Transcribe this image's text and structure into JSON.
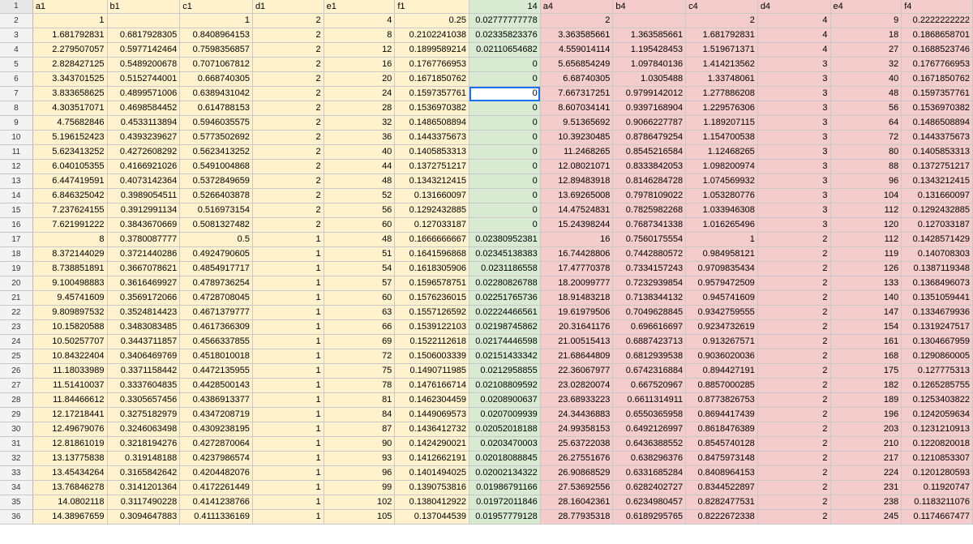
{
  "headers": [
    "a1",
    "b1",
    "c1",
    "d1",
    "e1",
    "f1",
    "14",
    "a4",
    "b4",
    "c4",
    "d4",
    "e4",
    "f4"
  ],
  "colors": {
    "yellow": "#fff2cc",
    "green": "#d9ead3",
    "red": "#f4cccc",
    "selection": "#1a73e8"
  },
  "active_cell": {
    "row": 7,
    "col": "G"
  },
  "rows": [
    [
      "1",
      "",
      "1",
      "2",
      "4",
      "0.25",
      "0.02777777778",
      "2",
      "",
      "2",
      "4",
      "9",
      "0.2222222222"
    ],
    [
      "1.681792831",
      "0.6817928305",
      "0.8408964153",
      "2",
      "8",
      "0.2102241038",
      "0.02335823376",
      "3.363585661",
      "1.363585661",
      "1.681792831",
      "4",
      "18",
      "0.1868658701"
    ],
    [
      "2.279507057",
      "0.5977142464",
      "0.7598356857",
      "2",
      "12",
      "0.1899589214",
      "0.02110654682",
      "4.559014114",
      "1.195428453",
      "1.519671371",
      "4",
      "27",
      "0.1688523746"
    ],
    [
      "2.828427125",
      "0.5489200678",
      "0.7071067812",
      "2",
      "16",
      "0.1767766953",
      "0",
      "5.656854249",
      "1.097840136",
      "1.414213562",
      "3",
      "32",
      "0.1767766953"
    ],
    [
      "3.343701525",
      "0.5152744001",
      "0.668740305",
      "2",
      "20",
      "0.1671850762",
      "0",
      "6.68740305",
      "1.0305488",
      "1.33748061",
      "3",
      "40",
      "0.1671850762"
    ],
    [
      "3.833658625",
      "0.4899571006",
      "0.6389431042",
      "2",
      "24",
      "0.1597357761",
      "0",
      "7.667317251",
      "0.9799142012",
      "1.277886208",
      "3",
      "48",
      "0.1597357761"
    ],
    [
      "4.303517071",
      "0.4698584452",
      "0.614788153",
      "2",
      "28",
      "0.1536970382",
      "0",
      "8.607034141",
      "0.9397168904",
      "1.229576306",
      "3",
      "56",
      "0.1536970382"
    ],
    [
      "4.75682846",
      "0.4533113894",
      "0.5946035575",
      "2",
      "32",
      "0.1486508894",
      "0",
      "9.51365692",
      "0.9066227787",
      "1.189207115",
      "3",
      "64",
      "0.1486508894"
    ],
    [
      "5.196152423",
      "0.4393239627",
      "0.5773502692",
      "2",
      "36",
      "0.1443375673",
      "0",
      "10.39230485",
      "0.8786479254",
      "1.154700538",
      "3",
      "72",
      "0.1443375673"
    ],
    [
      "5.623413252",
      "0.4272608292",
      "0.5623413252",
      "2",
      "40",
      "0.1405853313",
      "0",
      "11.2468265",
      "0.8545216584",
      "1.12468265",
      "3",
      "80",
      "0.1405853313"
    ],
    [
      "6.040105355",
      "0.4166921026",
      "0.5491004868",
      "2",
      "44",
      "0.1372751217",
      "0",
      "12.08021071",
      "0.8333842053",
      "1.098200974",
      "3",
      "88",
      "0.1372751217"
    ],
    [
      "6.447419591",
      "0.4073142364",
      "0.5372849659",
      "2",
      "48",
      "0.1343212415",
      "0",
      "12.89483918",
      "0.8146284728",
      "1.074569932",
      "3",
      "96",
      "0.1343212415"
    ],
    [
      "6.846325042",
      "0.3989054511",
      "0.5266403878",
      "2",
      "52",
      "0.131660097",
      "0",
      "13.69265008",
      "0.7978109022",
      "1.053280776",
      "3",
      "104",
      "0.131660097"
    ],
    [
      "7.237624155",
      "0.3912991134",
      "0.516973154",
      "2",
      "56",
      "0.1292432885",
      "0",
      "14.47524831",
      "0.7825982268",
      "1.033946308",
      "3",
      "112",
      "0.1292432885"
    ],
    [
      "7.621991222",
      "0.3843670669",
      "0.5081327482",
      "2",
      "60",
      "0.127033187",
      "0",
      "15.24398244",
      "0.7687341338",
      "1.016265496",
      "3",
      "120",
      "0.127033187"
    ],
    [
      "8",
      "0.3780087777",
      "0.5",
      "1",
      "48",
      "0.1666666667",
      "0.02380952381",
      "16",
      "0.7560175554",
      "1",
      "2",
      "112",
      "0.1428571429"
    ],
    [
      "8.372144029",
      "0.3721440286",
      "0.4924790605",
      "1",
      "51",
      "0.1641596868",
      "0.02345138383",
      "16.74428806",
      "0.7442880572",
      "0.984958121",
      "2",
      "119",
      "0.140708303"
    ],
    [
      "8.738851891",
      "0.3667078621",
      "0.4854917717",
      "1",
      "54",
      "0.1618305906",
      "0.0231186558",
      "17.47770378",
      "0.7334157243",
      "0.9709835434",
      "2",
      "126",
      "0.1387119348"
    ],
    [
      "9.100498883",
      "0.3616469927",
      "0.4789736254",
      "1",
      "57",
      "0.1596578751",
      "0.02280826788",
      "18.20099777",
      "0.7232939854",
      "0.9579472509",
      "2",
      "133",
      "0.1368496073"
    ],
    [
      "9.45741609",
      "0.3569172066",
      "0.4728708045",
      "1",
      "60",
      "0.1576236015",
      "0.02251765736",
      "18.91483218",
      "0.7138344132",
      "0.945741609",
      "2",
      "140",
      "0.1351059441"
    ],
    [
      "9.809897532",
      "0.3524814423",
      "0.4671379777",
      "1",
      "63",
      "0.1557126592",
      "0.02224466561",
      "19.61979506",
      "0.7049628845",
      "0.9342759555",
      "2",
      "147",
      "0.1334679936"
    ],
    [
      "10.15820588",
      "0.3483083485",
      "0.4617366309",
      "1",
      "66",
      "0.1539122103",
      "0.02198745862",
      "20.31641176",
      "0.696616697",
      "0.9234732619",
      "2",
      "154",
      "0.1319247517"
    ],
    [
      "10.50257707",
      "0.3443711857",
      "0.4566337855",
      "1",
      "69",
      "0.1522112618",
      "0.02174446598",
      "21.00515413",
      "0.6887423713",
      "0.913267571",
      "2",
      "161",
      "0.1304667959"
    ],
    [
      "10.84322404",
      "0.3406469769",
      "0.4518010018",
      "1",
      "72",
      "0.1506003339",
      "0.02151433342",
      "21.68644809",
      "0.6812939538",
      "0.9036020036",
      "2",
      "168",
      "0.1290860005"
    ],
    [
      "11.18033989",
      "0.3371158442",
      "0.4472135955",
      "1",
      "75",
      "0.1490711985",
      "0.0212958855",
      "22.36067977",
      "0.6742316884",
      "0.894427191",
      "2",
      "175",
      "0.127775313"
    ],
    [
      "11.51410037",
      "0.3337604835",
      "0.4428500143",
      "1",
      "78",
      "0.1476166714",
      "0.02108809592",
      "23.02820074",
      "0.667520967",
      "0.8857000285",
      "2",
      "182",
      "0.1265285755"
    ],
    [
      "11.84466612",
      "0.3305657456",
      "0.4386913377",
      "1",
      "81",
      "0.1462304459",
      "0.0208900637",
      "23.68933223",
      "0.6611314911",
      "0.8773826753",
      "2",
      "189",
      "0.1253403822"
    ],
    [
      "12.17218441",
      "0.3275182979",
      "0.4347208719",
      "1",
      "84",
      "0.1449069573",
      "0.0207009939",
      "24.34436883",
      "0.6550365958",
      "0.8694417439",
      "2",
      "196",
      "0.1242059634"
    ],
    [
      "12.49679076",
      "0.3246063498",
      "0.4309238195",
      "1",
      "87",
      "0.1436412732",
      "0.02052018188",
      "24.99358153",
      "0.6492126997",
      "0.8618476389",
      "2",
      "203",
      "0.1231210913"
    ],
    [
      "12.81861019",
      "0.3218194276",
      "0.4272870064",
      "1",
      "90",
      "0.1424290021",
      "0.0203470003",
      "25.63722038",
      "0.6436388552",
      "0.8545740128",
      "2",
      "210",
      "0.1220820018"
    ],
    [
      "13.13775838",
      "0.319148188",
      "0.4237986574",
      "1",
      "93",
      "0.1412662191",
      "0.02018088845",
      "26.27551676",
      "0.638296376",
      "0.8475973148",
      "2",
      "217",
      "0.1210853307"
    ],
    [
      "13.45434264",
      "0.3165842642",
      "0.4204482076",
      "1",
      "96",
      "0.1401494025",
      "0.02002134322",
      "26.90868529",
      "0.6331685284",
      "0.8408964153",
      "2",
      "224",
      "0.1201280593"
    ],
    [
      "13.76846278",
      "0.3141201364",
      "0.4172261449",
      "1",
      "99",
      "0.1390753816",
      "0.01986791166",
      "27.53692556",
      "0.6282402727",
      "0.8344522897",
      "2",
      "231",
      "0.11920747"
    ],
    [
      "14.0802118",
      "0.3117490228",
      "0.4141238766",
      "1",
      "102",
      "0.1380412922",
      "0.01972011846",
      "28.16042361",
      "0.6234980457",
      "0.8282477531",
      "2",
      "238",
      "0.1183211076"
    ],
    [
      "14.38967659",
      "0.3094647883",
      "0.4111336169",
      "1",
      "105",
      "0.137044539",
      "0.01957779128",
      "28.77935318",
      "0.6189295765",
      "0.8222672338",
      "2",
      "245",
      "0.1174667477"
    ]
  ]
}
